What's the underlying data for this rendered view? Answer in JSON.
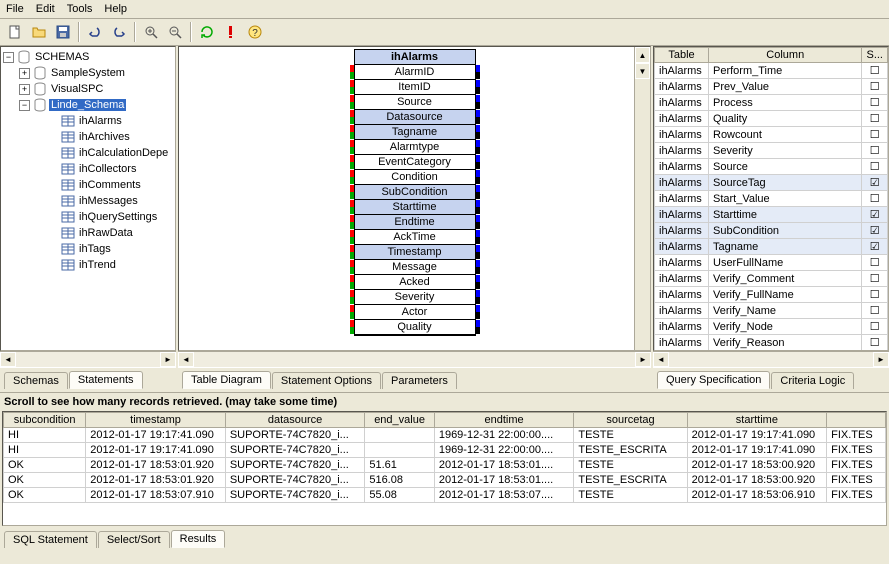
{
  "menu": [
    "File",
    "Edit",
    "Tools",
    "Help"
  ],
  "toolbar_icons": [
    "new-file-icon",
    "open-folder-icon",
    "save-icon",
    "undo-icon",
    "redo-icon",
    "zoom-in-icon",
    "zoom-out-icon",
    "refresh-icon",
    "error-icon",
    "help-icon"
  ],
  "tree": {
    "root": "SCHEMAS",
    "nodes": [
      {
        "label": "SampleSystem",
        "expanded": false,
        "children": []
      },
      {
        "label": "VisualSPC",
        "expanded": false,
        "children": []
      },
      {
        "label": "Linde_Schema",
        "expanded": true,
        "selected": true,
        "children": [
          {
            "label": "ihAlarms"
          },
          {
            "label": "ihArchives"
          },
          {
            "label": "ihCalculationDepe"
          },
          {
            "label": "ihCollectors"
          },
          {
            "label": "ihComments"
          },
          {
            "label": "ihMessages"
          },
          {
            "label": "ihQuerySettings"
          },
          {
            "label": "ihRawData"
          },
          {
            "label": "ihTags"
          },
          {
            "label": "ihTrend"
          }
        ]
      }
    ]
  },
  "left_tabs": {
    "tabs": [
      "Schemas",
      "Statements"
    ],
    "active": 1
  },
  "diagram": {
    "title": "ihAlarms",
    "fields": [
      {
        "n": "AlarmID"
      },
      {
        "n": "ItemID"
      },
      {
        "n": "Source"
      },
      {
        "n": "Datasource",
        "sel": true
      },
      {
        "n": "Tagname",
        "sel": true
      },
      {
        "n": "Alarmtype"
      },
      {
        "n": "EventCategory"
      },
      {
        "n": "Condition"
      },
      {
        "n": "SubCondition",
        "sel": true
      },
      {
        "n": "Starttime",
        "sel": true
      },
      {
        "n": "Endtime",
        "sel": true
      },
      {
        "n": "AckTime"
      },
      {
        "n": "Timestamp",
        "sel": true
      },
      {
        "n": "Message"
      },
      {
        "n": "Acked"
      },
      {
        "n": "Severity"
      },
      {
        "n": "Actor"
      },
      {
        "n": "Quality"
      }
    ]
  },
  "mid_tabs": {
    "tabs": [
      "Table Diagram",
      "Statement Options",
      "Parameters"
    ],
    "active": 0
  },
  "right_grid": {
    "headers": [
      "Table",
      "Column",
      "S..."
    ],
    "rows": [
      {
        "t": "ihAlarms",
        "c": "Perform_Time",
        "s": false
      },
      {
        "t": "ihAlarms",
        "c": "Prev_Value",
        "s": false
      },
      {
        "t": "ihAlarms",
        "c": "Process",
        "s": false
      },
      {
        "t": "ihAlarms",
        "c": "Quality",
        "s": false
      },
      {
        "t": "ihAlarms",
        "c": "Rowcount",
        "s": false
      },
      {
        "t": "ihAlarms",
        "c": "Severity",
        "s": false
      },
      {
        "t": "ihAlarms",
        "c": "Source",
        "s": false
      },
      {
        "t": "ihAlarms",
        "c": "SourceTag",
        "s": true,
        "sel": true
      },
      {
        "t": "ihAlarms",
        "c": "Start_Value",
        "s": false
      },
      {
        "t": "ihAlarms",
        "c": "Starttime",
        "s": true,
        "sel": true
      },
      {
        "t": "ihAlarms",
        "c": "SubCondition",
        "s": true,
        "sel": true
      },
      {
        "t": "ihAlarms",
        "c": "Tagname",
        "s": true,
        "sel": true
      },
      {
        "t": "ihAlarms",
        "c": "UserFullName",
        "s": false
      },
      {
        "t": "ihAlarms",
        "c": "Verify_Comment",
        "s": false
      },
      {
        "t": "ihAlarms",
        "c": "Verify_FullName",
        "s": false
      },
      {
        "t": "ihAlarms",
        "c": "Verify_Name",
        "s": false
      },
      {
        "t": "ihAlarms",
        "c": "Verify_Node",
        "s": false
      },
      {
        "t": "ihAlarms",
        "c": "Verify_Reason",
        "s": false
      }
    ]
  },
  "right_tabs": {
    "tabs": [
      "Query Specification",
      "Criteria Logic"
    ],
    "active": 0
  },
  "lower": {
    "message": "Scroll to see how many records retrieved.  (may take some time)",
    "headers": [
      "subcondition",
      "timestamp",
      "datasource",
      "end_value",
      "endtime",
      "sourcetag",
      "starttime",
      ""
    ],
    "rows": [
      [
        "HI",
        "2012-01-17 19:17:41.090",
        "SUPORTE-74C7820_i...",
        "",
        "1969-12-31 22:00:00....",
        "TESTE",
        "2012-01-17 19:17:41.090",
        "FIX.TES"
      ],
      [
        "HI",
        "2012-01-17 19:17:41.090",
        "SUPORTE-74C7820_i...",
        "",
        "1969-12-31 22:00:00....",
        "TESTE_ESCRITA",
        "2012-01-17 19:17:41.090",
        "FIX.TES"
      ],
      [
        "OK",
        "2012-01-17 18:53:01.920",
        "SUPORTE-74C7820_i...",
        "51.61",
        "2012-01-17 18:53:01....",
        "TESTE",
        "2012-01-17 18:53:00.920",
        "FIX.TES"
      ],
      [
        "OK",
        "2012-01-17 18:53:01.920",
        "SUPORTE-74C7820_i...",
        "516.08",
        "2012-01-17 18:53:01....",
        "TESTE_ESCRITA",
        "2012-01-17 18:53:00.920",
        "FIX.TES"
      ],
      [
        "OK",
        "2012-01-17 18:53:07.910",
        "SUPORTE-74C7820_i...",
        "55.08",
        "2012-01-17 18:53:07....",
        "TESTE",
        "2012-01-17 18:53:06.910",
        "FIX.TES"
      ]
    ],
    "tabs": {
      "tabs": [
        "SQL Statement",
        "Select/Sort",
        "Results"
      ],
      "active": 2
    }
  }
}
